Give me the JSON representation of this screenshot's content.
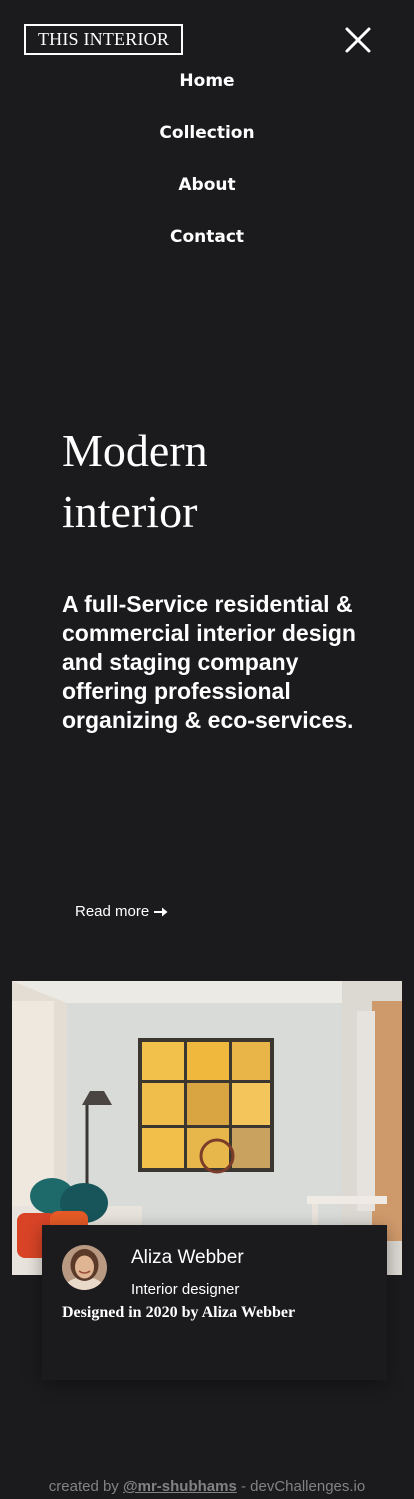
{
  "header": {
    "logo_text": "THIS INTERIOR",
    "close_icon": "close-icon"
  },
  "nav": {
    "items": [
      {
        "label": "Home"
      },
      {
        "label": "Collection"
      },
      {
        "label": "About"
      },
      {
        "label": "Contact"
      }
    ]
  },
  "hero": {
    "title_line1": "Modern",
    "title_line2": "interior",
    "description": "A full-Service residential & commercial interior design and staging company offering professional organizing & eco-services.",
    "read_more_label": "Read more",
    "read_more_icon": "arrow-right-icon"
  },
  "designer": {
    "name": "Aliza Webber",
    "role": "Interior designer",
    "caption": "Designed in 2020 by Aliza Webber"
  },
  "footer": {
    "prefix": "created by ",
    "author": "@mr-shubhams",
    "separator": " - ",
    "site": "devChallenges.io"
  },
  "colors": {
    "background": "#1b1a1d",
    "text": "#ffffff",
    "footer_text": "#828282"
  }
}
